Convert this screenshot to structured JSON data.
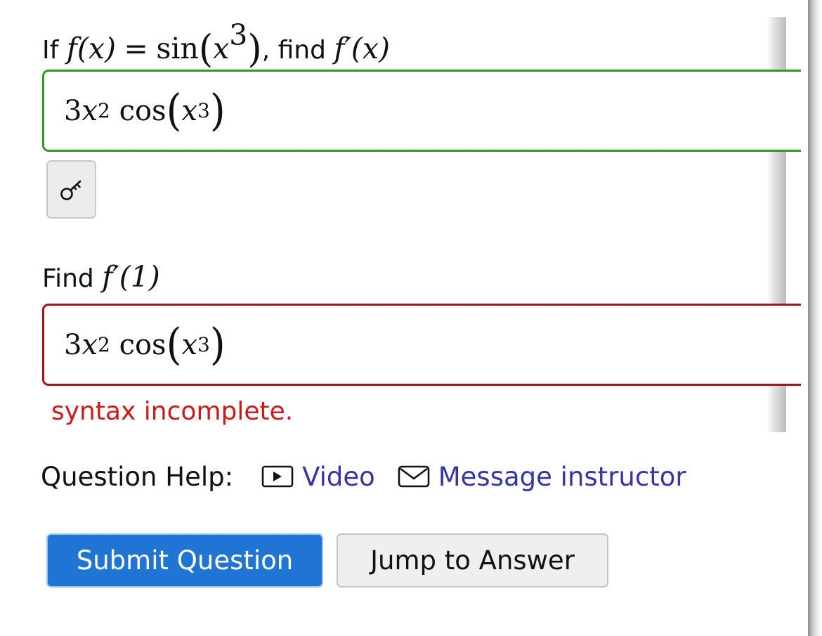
{
  "question1": {
    "prompt_if": "If",
    "prompt_fx": "f(x)",
    "prompt_eq": "=",
    "prompt_sin": "sin",
    "prompt_x": "x",
    "prompt_exp": "3",
    "prompt_find": ", find",
    "prompt_fprime": "f′(x)",
    "answer": {
      "coef": "3",
      "var": "x",
      "exp": "2",
      "fn": "cos",
      "inner_var": "x",
      "inner_exp": "3"
    },
    "status": "correct",
    "status_color": "#2e9a1f"
  },
  "key_button": {
    "icon": "key-icon"
  },
  "question2": {
    "prompt_find": "Find",
    "prompt_fprime": "f′(1)",
    "answer": {
      "coef": "3",
      "var": "x",
      "exp": "2",
      "fn": "cos",
      "inner_var": "x",
      "inner_exp": "3"
    },
    "status": "incorrect",
    "status_color": "#a31515",
    "error": "syntax incomplete."
  },
  "help": {
    "label": "Question Help:",
    "video_label": "Video",
    "video_icon": "play-icon",
    "message_label": "Message instructor",
    "message_icon": "envelope-icon",
    "link_color": "#3535a8"
  },
  "buttons": {
    "submit": "Submit Question",
    "jump": "Jump to Answer",
    "submit_color": "#2074d4"
  }
}
